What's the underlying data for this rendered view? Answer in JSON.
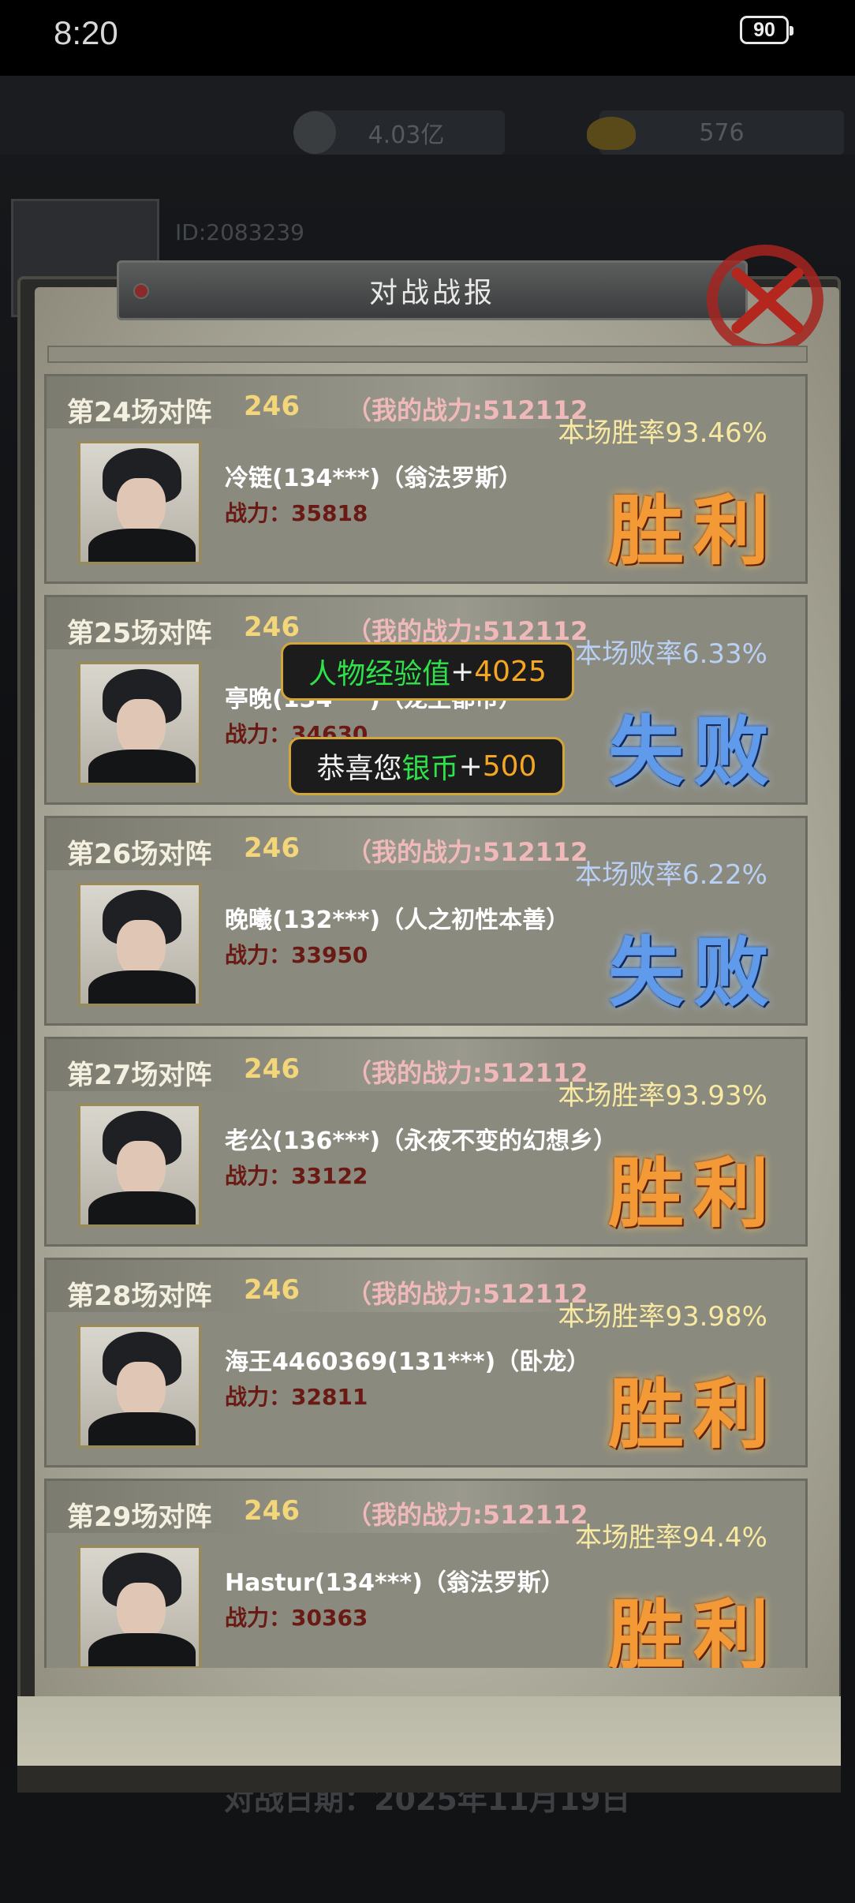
{
  "status_bar": {
    "time": "8:20",
    "battery": "90"
  },
  "background": {
    "silver": "4.03亿",
    "gold": "576",
    "player_id": "ID:2083239",
    "battle_date": "对战日期：2025年11月19日"
  },
  "dialog": {
    "title": "对战战报"
  },
  "matches": [
    {
      "title": "第24场对阵",
      "level": "246",
      "my_power": "（我的战力:512112",
      "rate": "本场胜率93.46%",
      "opponent": "冷链(134***)（翁法罗斯）",
      "power": "战力：35818",
      "result": "胜利",
      "outcome": "win"
    },
    {
      "title": "第25场对阵",
      "level": "246",
      "my_power": "（我的战力:512112",
      "rate": "本场败率6.33%",
      "opponent": "亭晚(134***)（龙王都市）",
      "power": "战力：34630",
      "result": "失败",
      "outcome": "lose"
    },
    {
      "title": "第26场对阵",
      "level": "246",
      "my_power": "（我的战力:512112",
      "rate": "本场败率6.22%",
      "opponent": "晚曦(132***)（人之初性本善）",
      "power": "战力：33950",
      "result": "失败",
      "outcome": "lose"
    },
    {
      "title": "第27场对阵",
      "level": "246",
      "my_power": "（我的战力:512112",
      "rate": "本场胜率93.93%",
      "opponent": "老公(136***)（永夜不变的幻想乡）",
      "power": "战力：33122",
      "result": "胜利",
      "outcome": "win"
    },
    {
      "title": "第28场对阵",
      "level": "246",
      "my_power": "（我的战力:512112",
      "rate": "本场胜率93.98%",
      "opponent": "海王4460369(131***)（卧龙）",
      "power": "战力：32811",
      "result": "胜利",
      "outcome": "win"
    },
    {
      "title": "第29场对阵",
      "level": "246",
      "my_power": "（我的战力:512112",
      "rate": "本场胜率94.4%",
      "opponent": "Hastur(134***)（翁法罗斯）",
      "power": "战力：30363",
      "result": "胜利",
      "outcome": "win"
    }
  ],
  "toasts": {
    "exp": {
      "label": "人物经验值",
      "plus": "+",
      "value": "4025"
    },
    "silver": {
      "prefix": "恭喜您",
      "label": "银币",
      "plus": "+",
      "value": "500"
    }
  }
}
